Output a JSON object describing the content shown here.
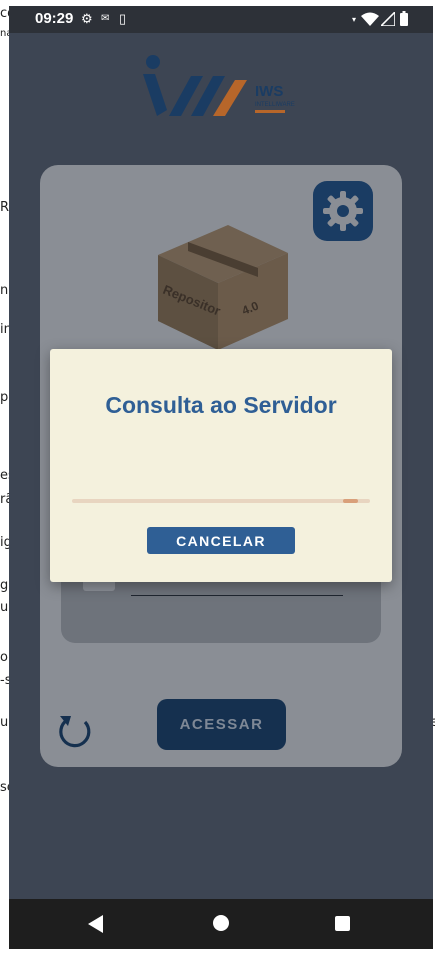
{
  "status_bar": {
    "time": "09:29",
    "icons": [
      "gear-icon",
      "notification-icon",
      "sim-icon",
      "wifi-icon",
      "signal-icon",
      "battery-icon"
    ]
  },
  "background_left_fragments": [
    "cd",
    "na",
    "R",
    "n c",
    "in",
    "pe",
    "es",
    "rã",
    "ig",
    "gu",
    "ui",
    "o",
    "-s",
    "ue",
    "se"
  ],
  "background_right_fragments": [
    "i",
    "e"
  ],
  "logo": {
    "name": "IWS",
    "tagline": "INTELLIWARE"
  },
  "card": {
    "box_label": "Repositor",
    "box_version": "4.0",
    "acessar_label": "ACESSAR"
  },
  "dialog": {
    "title": "Consulta ao Servidor",
    "progress_fraction": 0.96,
    "cancel_label": "CANCELAR"
  },
  "colors": {
    "dialog_bg": "#f4f1dd",
    "accent": "#2f5f95",
    "dark_blue": "#1a3c63",
    "orange": "#d9a07a"
  }
}
